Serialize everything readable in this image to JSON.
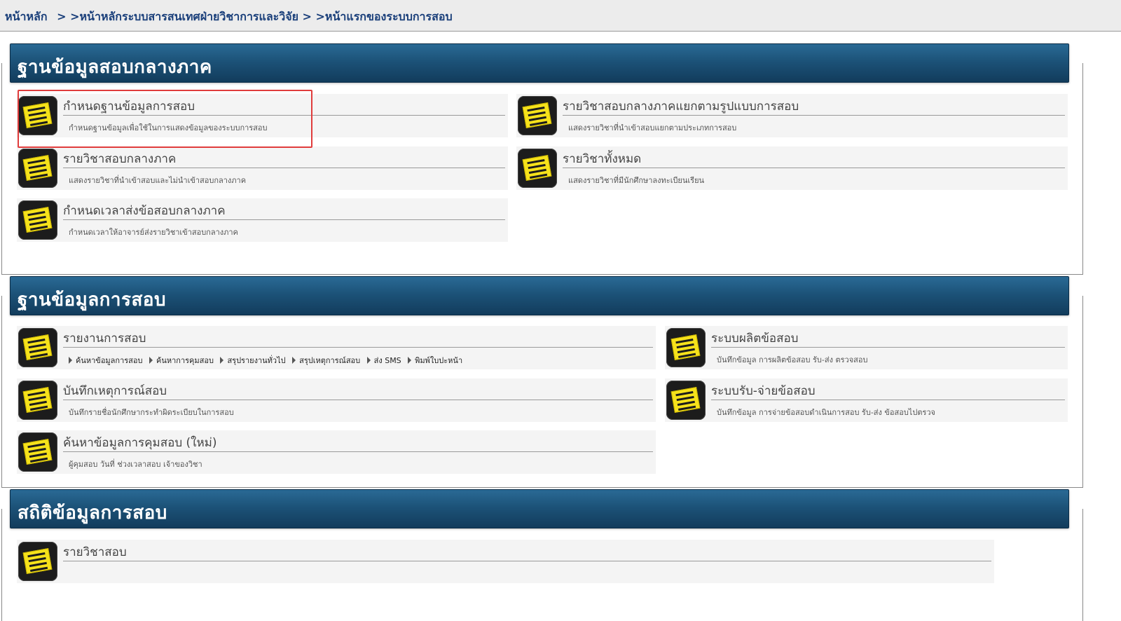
{
  "breadcrumb": {
    "home": "หน้าหลัก",
    "sep": " > ",
    "items": [
      ">หน้าหลักระบบสารสนเทศฝ่ายวิชาการและวิจัย",
      ">หน้าแรกของระบบการสอบ"
    ]
  },
  "sections": [
    {
      "title": "ฐานข้อมูลสอบกลางภาค",
      "cards": [
        {
          "title": "กำหนดฐานข้อมูลการสอบ",
          "desc": "กำหนดฐานข้อมูลเพื่อใช้ในการแสดงข้อมูลของระบบการสอบ"
        },
        {
          "title": "รายวิชาสอบกลางภาคแยกตามรูปแบบการสอบ",
          "desc": "แสดงรายวิชาที่นำเข้าสอบแยกตามประเภทการสอบ"
        },
        {
          "title": "รายวิชาสอบกลางภาค",
          "desc": "แสดงรายวิชาที่นำเข้าสอบและไม่นำเข้าสอบกลางภาค"
        },
        {
          "title": "รายวิชาทั้งหมด",
          "desc": "แสดงรายวิชาที่มีนักศึกษาลงทะเบียนเรียน"
        },
        {
          "title": "กำหนดเวลาส่งข้อสอบกลางภาค",
          "desc": "กำหนดเวลาให้อาจารย์ส่งรายวิชาเข้าสอบกลางภาค"
        }
      ]
    },
    {
      "title": "ฐานข้อมูลการสอบ",
      "cards": [
        {
          "title": "รายงานการสอบ",
          "links": [
            "ค้นหาข้อมูลการสอบ",
            "ค้นหาการคุมสอบ",
            "สรุปรายงานทั่วไป",
            "สรุปเหตุการณ์สอบ",
            "ส่ง SMS",
            "พิมพ์ใบปะหน้า"
          ]
        },
        {
          "title": "ระบบผลิตข้อสอบ",
          "desc": "บันทึกข้อมูล การผลิตข้อสอบ รับ-ส่ง ตรวจสอบ"
        },
        {
          "title": "บันทึกเหตุการณ์สอบ",
          "desc": "บันทึกรายชื่อนักศึกษากระทำผิดระเบียบในการสอบ"
        },
        {
          "title": "ระบบรับ-จ่ายข้อสอบ",
          "desc": "บันทึกข้อมูล การจ่ายข้อสอบดำเนินการสอบ รับ-ส่ง ข้อสอบไปตรวจ"
        },
        {
          "title": "ค้นหาข้อมูลการคุมสอบ (ใหม่)",
          "desc": "ผู้คุมสอบ วันที่ ช่วงเวลาสอบ เจ้าของวิชา"
        }
      ]
    },
    {
      "title": "สถิติข้อมูลการสอบ",
      "cards": [
        {
          "title": "รายวิชาสอบ",
          "desc": ""
        }
      ]
    }
  ],
  "colors": {
    "header_bg": "#1c5278",
    "highlight": "#e03c3c",
    "icon_note": "#f6e21b"
  }
}
